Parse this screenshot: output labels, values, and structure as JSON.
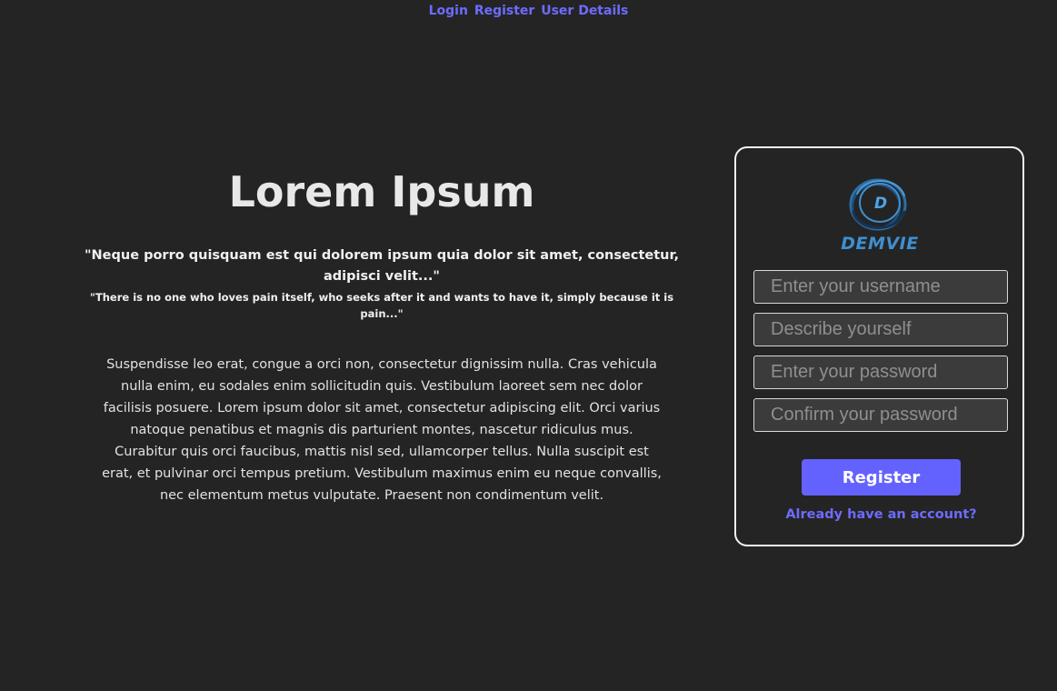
{
  "nav": {
    "login": "Login",
    "register": "Register",
    "user_details": "User Details"
  },
  "hero": {
    "title": "Lorem Ipsum",
    "quote_primary": "\"Neque porro quisquam est qui dolorem ipsum quia dolor sit amet, consectetur, adipisci velit...\"",
    "quote_secondary": "\"There is no one who loves pain itself, who seeks after it and wants to have it, simply because it is pain...\"",
    "body": "Suspendisse leo erat, congue a orci non, consectetur dignissim nulla. Cras vehicula nulla enim, eu sodales enim sollicitudin quis. Vestibulum laoreet sem nec dolor facilisis posuere. Lorem ipsum dolor sit amet, consectetur adipiscing elit. Orci varius natoque penatibus et magnis dis parturient montes, nascetur ridiculus mus. Curabitur quis orci faucibus, mattis nisl sed, ullamcorper tellus. Nulla suscipit est erat, et pulvinar orci tempus pretium. Vestibulum maximus enim eu neque convallis, nec elementum metus vulputate. Praesent non condimentum velit."
  },
  "form": {
    "logo_text": "DEMVIE",
    "logo_letter": "D",
    "username_placeholder": "Enter your username",
    "description_placeholder": "Describe yourself",
    "password_placeholder": "Enter your password",
    "confirm_placeholder": "Confirm your password",
    "register_label": "Register",
    "login_link": "Already have an account?"
  },
  "colors": {
    "background": "#242424",
    "accent": "#6462ff",
    "link": "#6e6bff",
    "logo": "#3f8fd0"
  }
}
